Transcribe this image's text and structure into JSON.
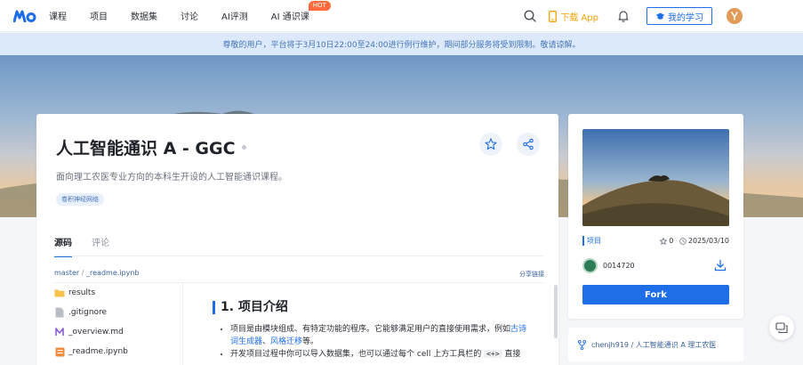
{
  "header": {
    "nav": [
      {
        "label": "课程"
      },
      {
        "label": "项目"
      },
      {
        "label": "数据集"
      },
      {
        "label": "讨论"
      },
      {
        "label": "AI评测"
      },
      {
        "label": "AI 通识课"
      }
    ],
    "hot_badge": "HOT",
    "download_label": "下载 App",
    "study_label": "我的学习"
  },
  "notice": "尊敬的用户，平台将于3月10日22:00至24:00进行例行维护，期间部分服务将受到限制。敬请谅解。",
  "project": {
    "title": "人工智能通识 A - GGC",
    "description": "面向理工农医专业方向的本科生开设的人工智能通识课程。",
    "tag": "卷积神经网络",
    "tabs": [
      {
        "label": "源码",
        "active": true
      },
      {
        "label": "评论",
        "active": false
      }
    ],
    "path": {
      "branch": "master",
      "separator": "/",
      "file": "_readme.ipynb"
    },
    "share_link": "分享链接",
    "files": [
      {
        "name": "results",
        "icon": "folder-icon"
      },
      {
        "name": ".gitignore",
        "icon": "file-icon"
      },
      {
        "name": "_overview.md",
        "icon": "markdown-icon"
      },
      {
        "name": "_readme.ipynb",
        "icon": "notebook-icon"
      }
    ],
    "readme": {
      "heading": "1. 项目介绍",
      "bullet1_text": "项目是由模块组成、有特定功能的程序。它能够满足用户的直接使用需求，例如",
      "bullet1_link1": "古诗词生成器",
      "bullet1_sep": "、",
      "bullet1_link2": "风格迁移",
      "bullet1_end": "等。",
      "bullet2_text": "开发项目过程中你可以导入数据集，也可以通过每个 cell 上方工具栏的",
      "bullet2_code": "<+>",
      "bullet2_end": "直接"
    }
  },
  "sidebar": {
    "type_label": "项目",
    "stars": "0",
    "date": "2025/03/10",
    "owner": "0014720",
    "fork_label": "Fork",
    "fork_source": "chenjh919 / 人工智能通识 A 理工农医"
  },
  "colors": {
    "accent": "#1e6ee8",
    "hot": "#ff6a3d",
    "download": "#f4a200",
    "notice_bg": "#dbe9fb"
  }
}
